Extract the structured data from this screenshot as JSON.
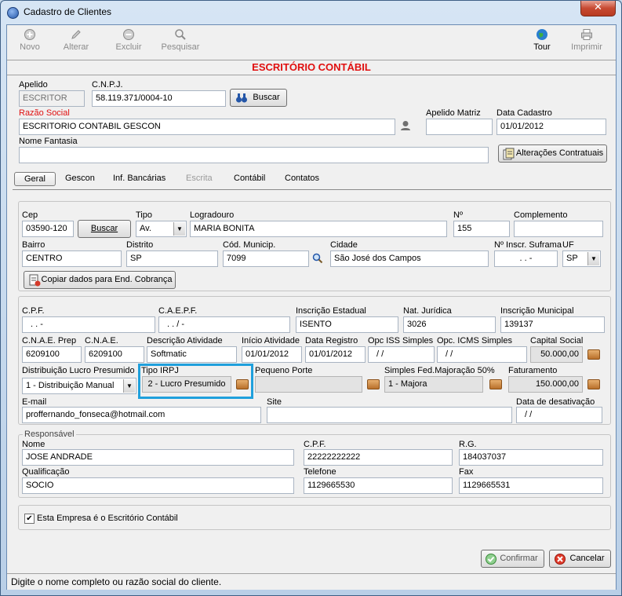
{
  "window": {
    "title": "Cadastro de Clientes",
    "close_glyph": "✕"
  },
  "toolbar": {
    "novo": "Novo",
    "alterar": "Alterar",
    "excluir": "Excluir",
    "pesquisar": "Pesquisar",
    "tour": "Tour",
    "imprimir": "Imprimir"
  },
  "header": {
    "office_title": "ESCRITÓRIO CONTÁBIL"
  },
  "company": {
    "apelido_label": "Apelido",
    "apelido_value": "ESCRITOR",
    "cnpj_label": "C.N.P.J.",
    "cnpj_value": "58.119.371/0004-10",
    "buscar_label": "Buscar",
    "razao_label": "Razão Social",
    "razao_value": "ESCRITORIO CONTABIL GESCON",
    "apelido_matriz_label": "Apelido Matriz",
    "apelido_matriz_value": "",
    "data_cadastro_label": "Data Cadastro",
    "data_cadastro_value": "01/01/2012",
    "nome_fantasia_label": "Nome Fantasia",
    "nome_fantasia_value": "",
    "alteracoes_label": "Alterações Contratuais"
  },
  "tabs": [
    "Geral",
    "Gescon",
    "Inf. Bancárias",
    "Escrita",
    "Contábil",
    "Contatos"
  ],
  "address": {
    "cep_label": "Cep",
    "cep_value": "03590-120",
    "buscar_label": "Buscar",
    "tipo_label": "Tipo",
    "tipo_value": "Av.",
    "logradouro_label": "Logradouro",
    "logradouro_value": "MARIA BONITA",
    "numero_label": "Nº",
    "numero_value": "155",
    "complemento_label": "Complemento",
    "complemento_value": "",
    "bairro_label": "Bairro",
    "bairro_value": "CENTRO",
    "distrito_label": "Distrito",
    "distrito_value": "SP",
    "cod_municip_label": "Cód. Municip.",
    "cod_municip_value": "7099",
    "cidade_label": "Cidade",
    "cidade_value": "São José dos Campos",
    "suframa_label": "Nº Inscr. Suframa",
    "suframa_value": ". . -",
    "uf_label": "UF",
    "uf_value": "SP",
    "copiar_label": "Copiar dados para End. Cobrança"
  },
  "fiscal": {
    "cpf_label": "C.P.F.",
    "cpf_value": ". . -",
    "caepf_label": "C.A.E.P.F.",
    "caepf_value": ". . / -",
    "ie_label": "Inscrição Estadual",
    "ie_value": "ISENTO",
    "nat_juridica_label": "Nat. Jurídica",
    "nat_juridica_value": "3026",
    "im_label": "Inscrição Municipal",
    "im_value": "139137",
    "cnae_prep_label": "C.N.A.E. Prep",
    "cnae_prep_value": "6209100",
    "cnae_label": "C.N.A.E.",
    "cnae_value": "6209100",
    "desc_ativ_label": "Descrição Atividade",
    "desc_ativ_value": "Softmatic",
    "inicio_ativ_label": "Início Atividade",
    "inicio_ativ_value": "01/01/2012",
    "data_registro_label": "Data Registro",
    "data_registro_value": "01/01/2012",
    "opc_iss_label": "Opc ISS Simples",
    "opc_iss_value": "/ /",
    "opc_icms_label": "Opc. ICMS Simples",
    "opc_icms_value": "/ /",
    "capital_label": "Capital Social",
    "capital_value": "50.000,00",
    "dist_lucro_label": "Distribuição Lucro Presumido",
    "dist_lucro_value": "1 - Distribuição Manual",
    "tipo_irpj_label": "Tipo IRPJ",
    "tipo_irpj_value": "2 - Lucro Presumido",
    "pequeno_porte_label": "Pequeno Porte",
    "pequeno_porte_value": "",
    "simples_label": "Simples Fed.Majoração 50%",
    "simples_value": "1 - Majora",
    "faturamento_label": "Faturamento",
    "faturamento_value": "150.000,00",
    "email_label": "E-mail",
    "email_value": "proffernando_fonseca@hotmail.com",
    "site_label": "Site",
    "site_value": "",
    "desativacao_label": "Data de desativação",
    "desativacao_value": "/ /"
  },
  "responsavel": {
    "group_label": "Responsável",
    "nome_label": "Nome",
    "nome_value": "JOSE ANDRADE",
    "cpf_label": "C.P.F.",
    "cpf_value": "22222222222",
    "rg_label": "R.G.",
    "rg_value": "184037037",
    "qualificacao_label": "Qualificação",
    "qualificacao_value": "SOCIO",
    "telefone_label": "Telefone",
    "telefone_value": "1129665530",
    "fax_label": "Fax",
    "fax_value": "1129665531"
  },
  "options": {
    "escritorio_check_label": "Esta Empresa é o Escritório Contábil",
    "escritorio_checked": true
  },
  "footer": {
    "confirmar": "Confirmar",
    "cancelar": "Cancelar",
    "status_text": "Digite o nome completo ou razão social do cliente."
  },
  "colors": {
    "accent_red": "#e01010",
    "highlight_blue": "#1fa0dc"
  }
}
